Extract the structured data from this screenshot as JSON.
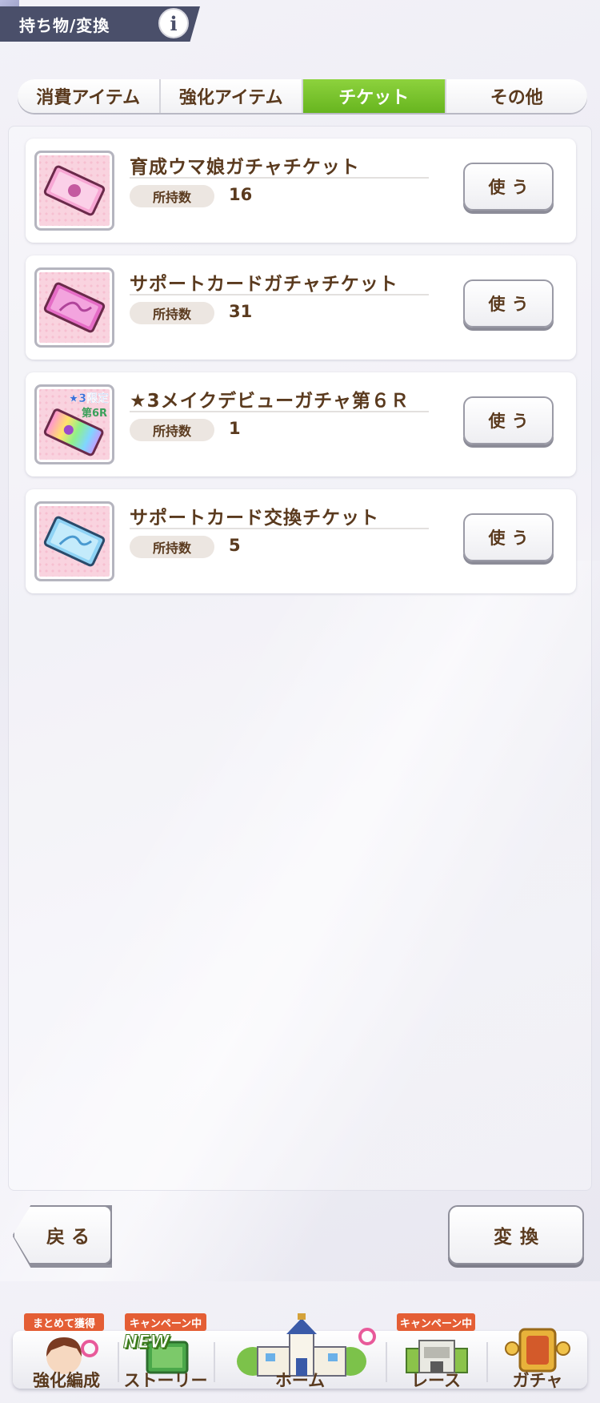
{
  "header": {
    "title": "持ち物/変換",
    "info_label": "i"
  },
  "tabs": [
    {
      "label": "消費アイテム",
      "active": false
    },
    {
      "label": "強化アイテム",
      "active": false
    },
    {
      "label": "チケット",
      "active": true
    },
    {
      "label": "その他",
      "active": false
    }
  ],
  "tickets": [
    {
      "name": "育成ウマ娘ガチャチケット",
      "owned_label": "所持数",
      "count": "16",
      "use_label": "使う",
      "icon": "pink-gacha-ticket-icon"
    },
    {
      "name": "サポートカードガチャチケット",
      "owned_label": "所持数",
      "count": "31",
      "use_label": "使う",
      "icon": "magenta-support-ticket-icon"
    },
    {
      "name": "★3メイクデビューガチャ第６Ｒ",
      "owned_label": "所持数",
      "count": "1",
      "use_label": "使う",
      "icon": "rainbow-limited-ticket-icon",
      "icon_badge_top": "★3限定",
      "icon_badge_bottom": "第6R"
    },
    {
      "name": "サポートカード交換チケット",
      "owned_label": "所持数",
      "count": "5",
      "use_label": "使う",
      "icon": "blue-exchange-ticket-icon"
    }
  ],
  "footer_buttons": {
    "back_label": "戻る",
    "exchange_label": "変換"
  },
  "bottom_nav": [
    {
      "label": "強化編成",
      "tag": "まとめて獲得"
    },
    {
      "label": "ストーリー",
      "tag": "キャンペーン中",
      "badge": "NEW"
    },
    {
      "label": "ホーム",
      "tag": ""
    },
    {
      "label": "レース",
      "tag": "キャンペーン中"
    },
    {
      "label": "ガチャ",
      "tag": ""
    }
  ],
  "colors": {
    "accent_green": "#67b51f",
    "text_brown": "#5a3a1e",
    "header_bg": "#4a4f6a",
    "tag_orange": "#e45e35"
  }
}
